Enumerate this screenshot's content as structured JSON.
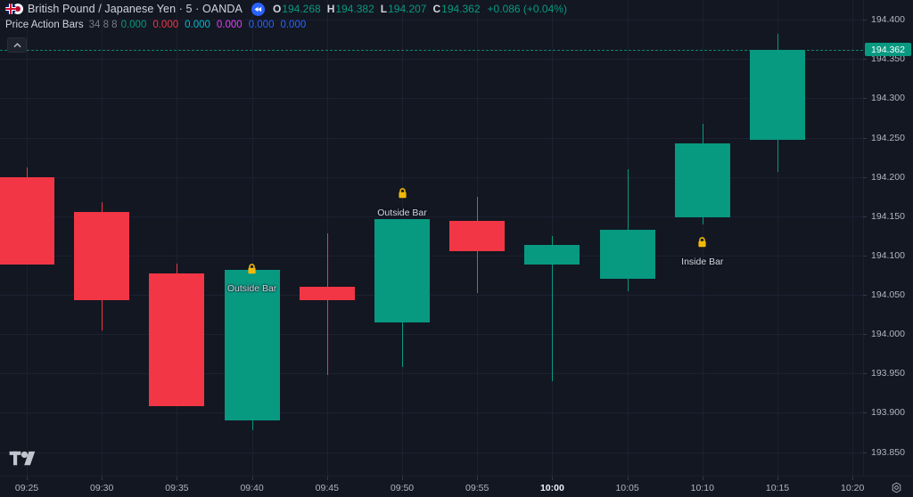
{
  "header": {
    "symbol_title": "British Pound / Japanese Yen · 5 · OANDA",
    "flag_icon": "gbp-jpy-flag-pair-icon",
    "replay_icon": "replay-rewind-icon",
    "ohlc": {
      "o_label": "O",
      "o_value": "194.268",
      "h_label": "H",
      "h_value": "194.382",
      "l_label": "L",
      "l_value": "194.207",
      "c_label": "C",
      "c_value": "194.362",
      "change": "+0.086 (+0.04%)"
    },
    "indicator": {
      "name": "Price Action Bars",
      "params": "34 8 8",
      "values": [
        "0.000",
        "0.000",
        "0.000",
        "0.000",
        "0.000",
        "0.000"
      ],
      "colors": [
        "#089981",
        "#f23645",
        "#00bcd4",
        "#e040fb",
        "#2962ff",
        "#2962ff"
      ]
    },
    "collapse_icon": "chevron-up-icon"
  },
  "footer": {
    "logo": "tradingview-logo",
    "settings_icon": "time-axis-settings-icon"
  },
  "colors": {
    "background": "#131722",
    "grid": "#1c2030",
    "up": "#089981",
    "down": "#f23645",
    "text": "#d1d4dc",
    "muted": "#b2b5be",
    "accent": "#2962ff",
    "marker": "#f0b90b"
  },
  "chart_data": {
    "type": "candlestick",
    "title": "British Pound / Japanese Yen · 5 · OANDA",
    "xlabel": "",
    "ylabel": "",
    "ylim": [
      193.82,
      194.425
    ],
    "grid": true,
    "legend": "none",
    "price_axis_ticks": [
      "194.400",
      "194.350",
      "194.300",
      "194.250",
      "194.200",
      "194.150",
      "194.100",
      "194.050",
      "194.000",
      "193.950",
      "193.900",
      "193.850"
    ],
    "price_axis_values": [
      194.4,
      194.35,
      194.3,
      194.25,
      194.2,
      194.15,
      194.1,
      194.05,
      194.0,
      193.95,
      193.9,
      193.85
    ],
    "current_price": "194.362",
    "current_price_value": 194.362,
    "time_ticks": [
      "09:25",
      "09:30",
      "09:35",
      "09:40",
      "09:45",
      "09:50",
      "09:55",
      "10:00",
      "10:05",
      "10:10",
      "10:15",
      "10:20"
    ],
    "time_tick_bold": "10:00",
    "candles": [
      {
        "time": "09:25",
        "open": 194.2,
        "high": 194.212,
        "low": 194.088,
        "close": 194.088,
        "dir": "down"
      },
      {
        "time": "09:30",
        "open": 194.155,
        "high": 194.168,
        "low": 194.005,
        "close": 194.043,
        "dir": "down"
      },
      {
        "time": "09:35",
        "open": 194.077,
        "high": 194.09,
        "low": 193.908,
        "close": 193.908,
        "dir": "down"
      },
      {
        "time": "09:40",
        "open": 193.89,
        "high": 194.082,
        "low": 193.878,
        "close": 194.082,
        "dir": "up"
      },
      {
        "time": "09:45",
        "open": 194.043,
        "high": 194.128,
        "low": 193.948,
        "close": 194.06,
        "dir": "down"
      },
      {
        "time": "09:50",
        "open": 194.015,
        "high": 194.146,
        "low": 193.958,
        "close": 194.146,
        "dir": "up"
      },
      {
        "time": "09:55",
        "open": 194.144,
        "high": 194.175,
        "low": 194.052,
        "close": 194.105,
        "dir": "down"
      },
      {
        "time": "10:00",
        "open": 194.113,
        "high": 194.125,
        "low": 193.94,
        "close": 194.088,
        "dir": "up"
      },
      {
        "time": "10:05",
        "open": 194.07,
        "high": 194.21,
        "low": 194.055,
        "close": 194.133,
        "dir": "up"
      },
      {
        "time": "10:10",
        "open": 194.148,
        "high": 194.268,
        "low": 194.14,
        "close": 194.243,
        "dir": "up"
      },
      {
        "time": "10:15",
        "open": 194.247,
        "high": 194.382,
        "low": 194.207,
        "close": 194.362,
        "dir": "up"
      }
    ],
    "annotations": [
      {
        "label": "Outside Bar",
        "icon": "lock-icon",
        "time": "09:40"
      },
      {
        "label": "Outside Bar",
        "icon": "lock-icon",
        "time": "09:50"
      },
      {
        "label": "Inside Bar",
        "icon": "lock-icon",
        "time": "10:10"
      }
    ]
  }
}
